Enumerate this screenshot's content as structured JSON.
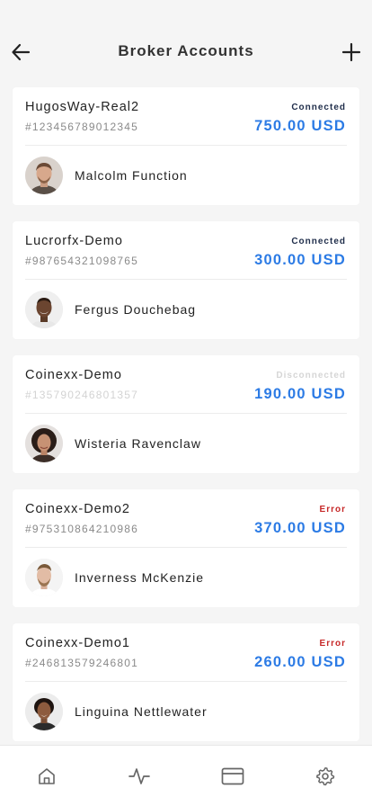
{
  "header": {
    "title": "Broker Accounts",
    "back_icon": "arrow-left-icon",
    "add_icon": "plus-icon"
  },
  "colors": {
    "connected": "#1f2d4a",
    "disconnected": "#d6d6d6",
    "error": "#c62828",
    "balance": "#2c7be5"
  },
  "accounts": [
    {
      "name": "HugosWay-Real2",
      "number": "#123456789012345",
      "status": "Connected",
      "balance": "750.00 USD",
      "owner": "Malcolm Function"
    },
    {
      "name": "Lucrorfx-Demo",
      "number": "#987654321098765",
      "status": "Connected",
      "balance": "300.00 USD",
      "owner": "Fergus Douchebag"
    },
    {
      "name": "Coinexx-Demo",
      "number": "#135790246801357",
      "status": "Disconnected",
      "balance": "190.00 USD",
      "owner": "Wisteria Ravenclaw"
    },
    {
      "name": "Coinexx-Demo2",
      "number": "#975310864210986",
      "status": "Error",
      "balance": "370.00 USD",
      "owner": "Inverness McKenzie"
    },
    {
      "name": "Coinexx-Demo1",
      "number": "#246813579246801",
      "status": "Error",
      "balance": "260.00 USD",
      "owner": "Linguina Nettlewater"
    }
  ],
  "nav": {
    "items": [
      "home-icon",
      "activity-icon",
      "card-icon",
      "settings-icon"
    ]
  }
}
